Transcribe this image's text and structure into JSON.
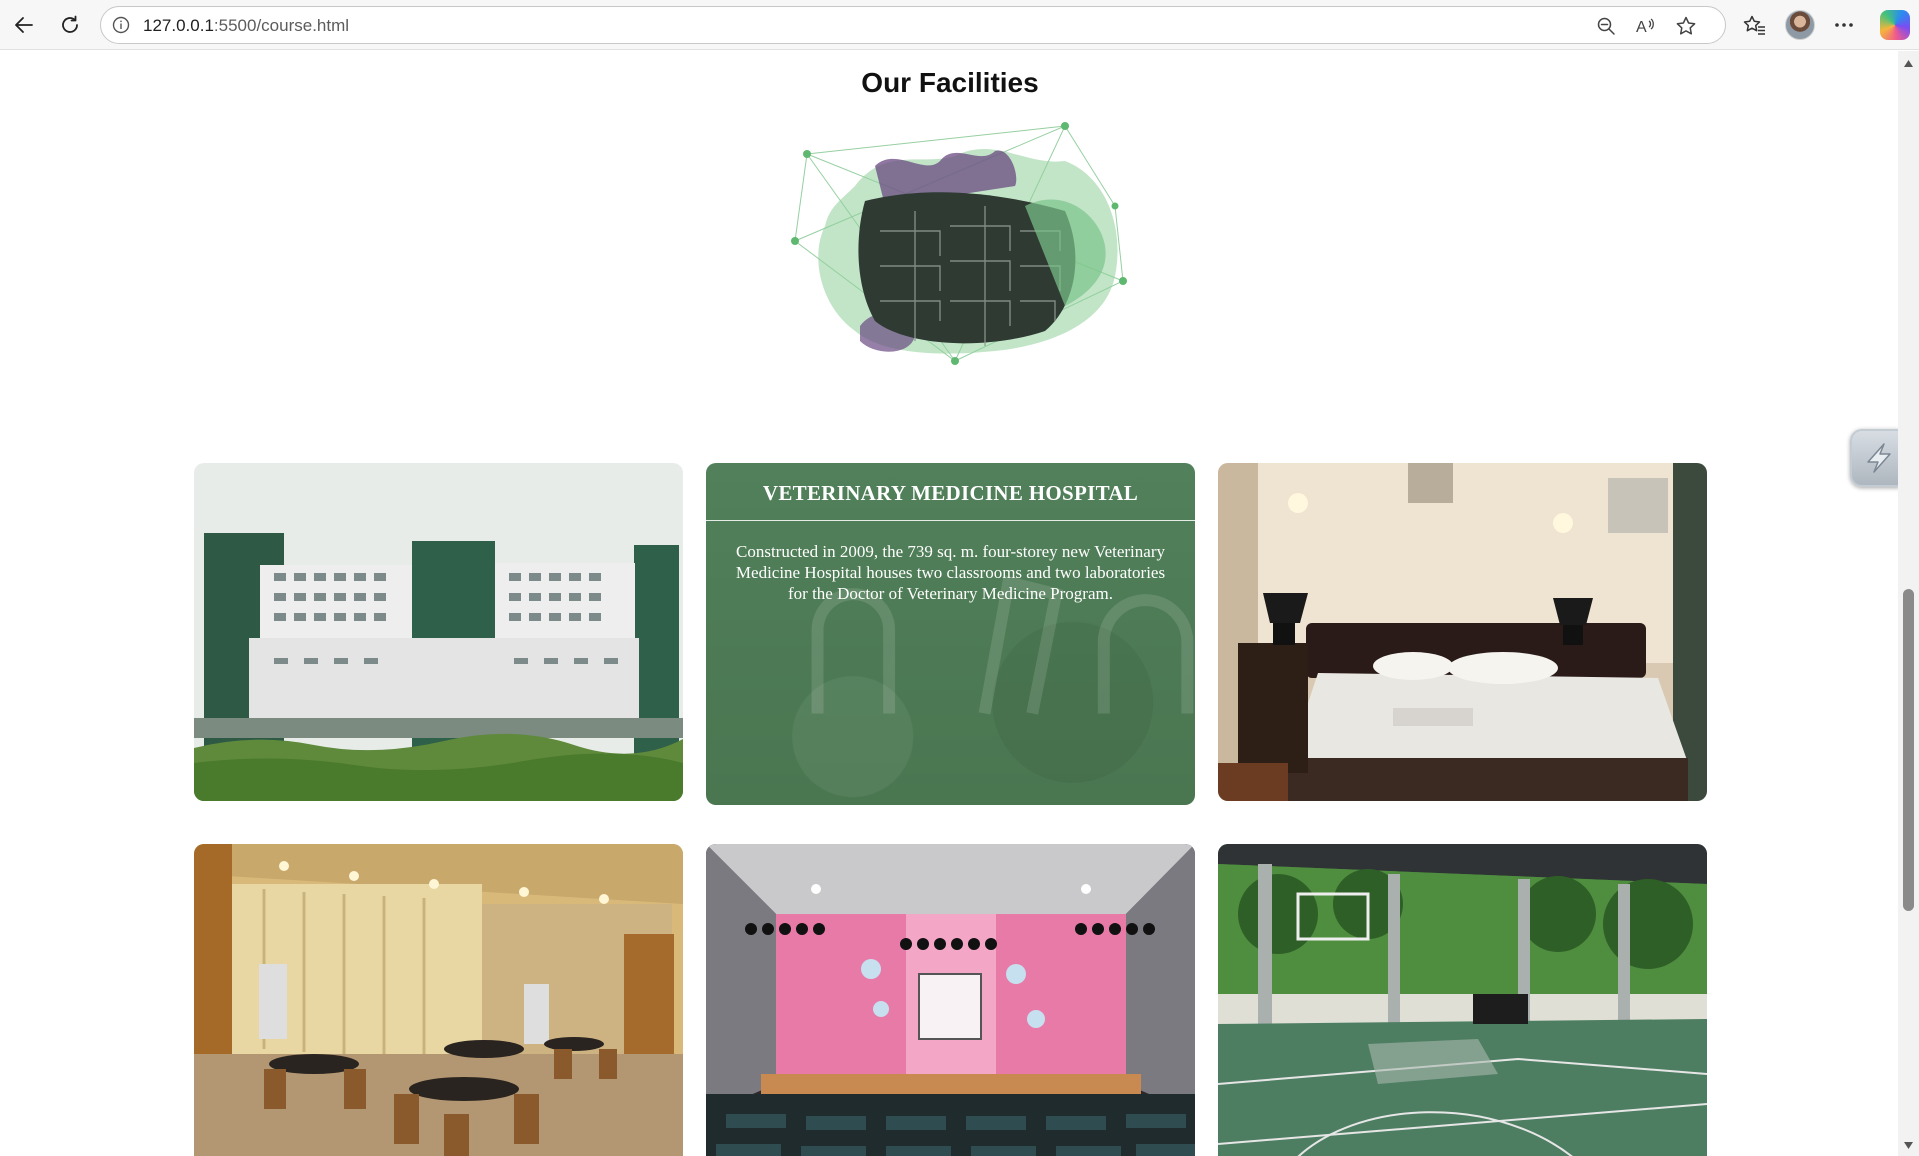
{
  "browser": {
    "url_host": "127.0.0.1",
    "url_rest": ":5500/course.html",
    "icons": [
      "back-icon",
      "refresh-icon",
      "info-icon",
      "zoom-out-icon",
      "read-aloud-icon",
      "favorite-star-icon",
      "favorites-icon",
      "profile-avatar",
      "more-icon",
      "copilot-icon"
    ]
  },
  "page": {
    "title": "Our Facilities"
  },
  "facilities": [
    {
      "name": "building-photo"
    },
    {
      "name": "veterinary-hospital",
      "heading": "VETERINARY MEDICINE HOSPITAL",
      "description": "Constructed in 2009, the 739 sq. m. four-storey new Veterinary Medicine Hospital houses two classrooms and two laboratories for the Doctor of Veterinary Medicine Program."
    },
    {
      "name": "hotel-room-photo"
    },
    {
      "name": "dining-hall-photo"
    },
    {
      "name": "auditorium-photo"
    },
    {
      "name": "basketball-court-photo"
    }
  ],
  "colors": {
    "detail_card": "#4d7a50",
    "scroll_thumb": "#8a8a8a"
  }
}
